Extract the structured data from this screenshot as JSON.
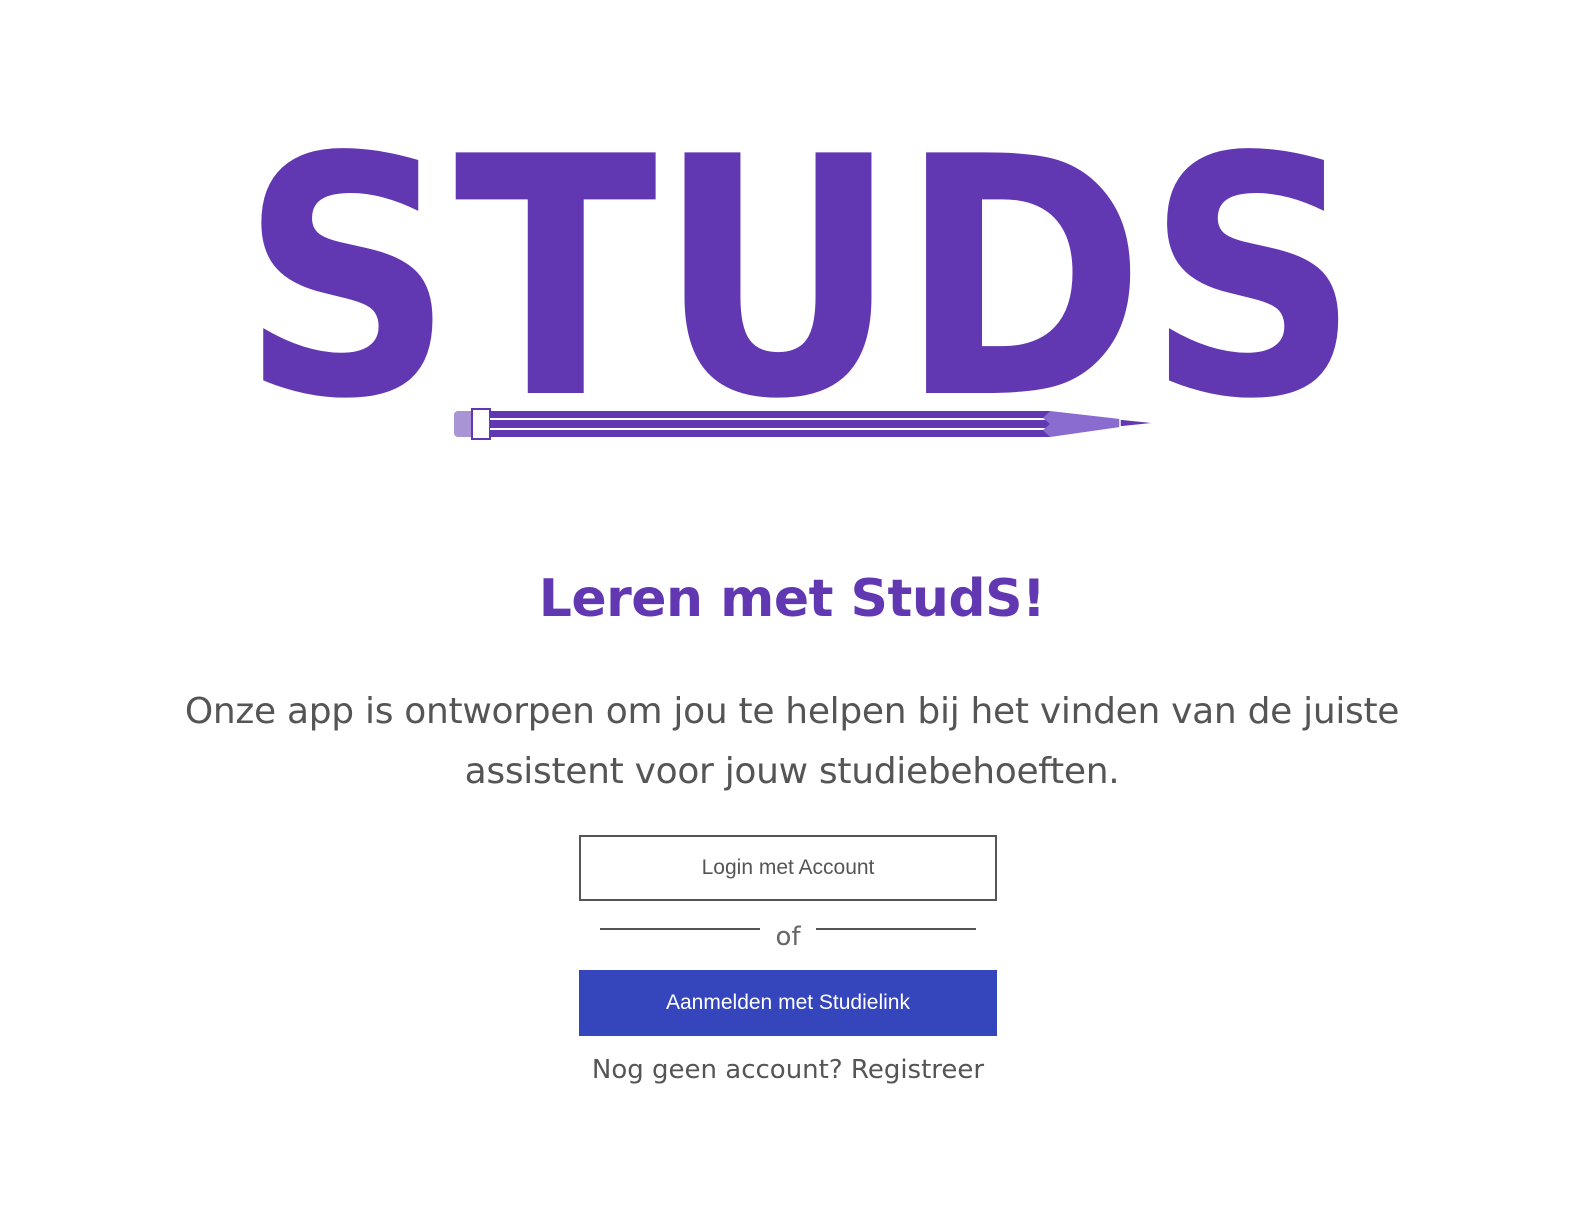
{
  "logo": {
    "text": "StudS",
    "brand_color": "#6237b2",
    "icon": "pencil-icon"
  },
  "headline": "Leren met StudS!",
  "intro": "Onze app is ontworpen om jou te helpen bij het vinden van de juiste assistent voor jouw studiebehoeften.",
  "login_button_label": "Login met Account",
  "divider_text": "of",
  "studielink_button_label": "Aanmelden met Studielink",
  "register": {
    "prompt": "Nog geen account?",
    "link_label": "Registreer"
  },
  "colors": {
    "brand_purple": "#6237b2",
    "button_blue": "#3546bd",
    "text_gray": "#555555"
  }
}
